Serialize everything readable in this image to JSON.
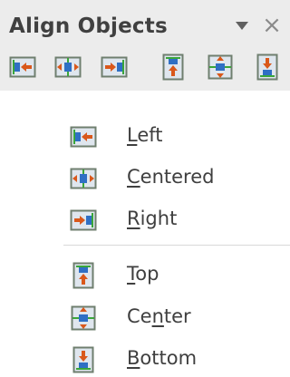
{
  "toolbar": {
    "title": "Align Objects",
    "menu_icon": "dropdown-triangle-icon",
    "close_label": "×",
    "buttons": [
      {
        "name": "align-left-button",
        "icon": "align-left-icon"
      },
      {
        "name": "align-centered-button",
        "icon": "align-centered-icon"
      },
      {
        "name": "align-right-button",
        "icon": "align-right-icon"
      },
      {
        "name": "align-top-button",
        "icon": "align-top-icon"
      },
      {
        "name": "align-center-button",
        "icon": "align-center-icon"
      },
      {
        "name": "align-bottom-button",
        "icon": "align-bottom-icon"
      }
    ]
  },
  "menu": {
    "items": [
      {
        "label": "Left",
        "mnemonic": "L",
        "rest": "eft",
        "icon": "align-left-icon"
      },
      {
        "label": "Centered",
        "mnemonic": "C",
        "rest": "entered",
        "icon": "align-centered-icon"
      },
      {
        "label": "Right",
        "mnemonic": "R",
        "rest": "ight",
        "icon": "align-right-icon"
      },
      {
        "label": "Top",
        "mnemonic": "T",
        "rest": "op",
        "icon": "align-top-icon"
      },
      {
        "label": "Center",
        "pre": "Ce",
        "mnemonic": "n",
        "rest": "ter",
        "icon": "align-center-icon"
      },
      {
        "label": "Bottom",
        "mnemonic": "B",
        "rest": "ottom",
        "icon": "align-bottom-icon"
      }
    ]
  },
  "colors": {
    "toolbar_bg": "#ececec",
    "icon_frame": "#6f7f6f",
    "icon_fill": "#dfe6ee",
    "blue_block": "#2f6fc4",
    "arrow_orange": "#d9581b",
    "guide_green": "#3aa63a",
    "text": "#3f3f3f"
  }
}
